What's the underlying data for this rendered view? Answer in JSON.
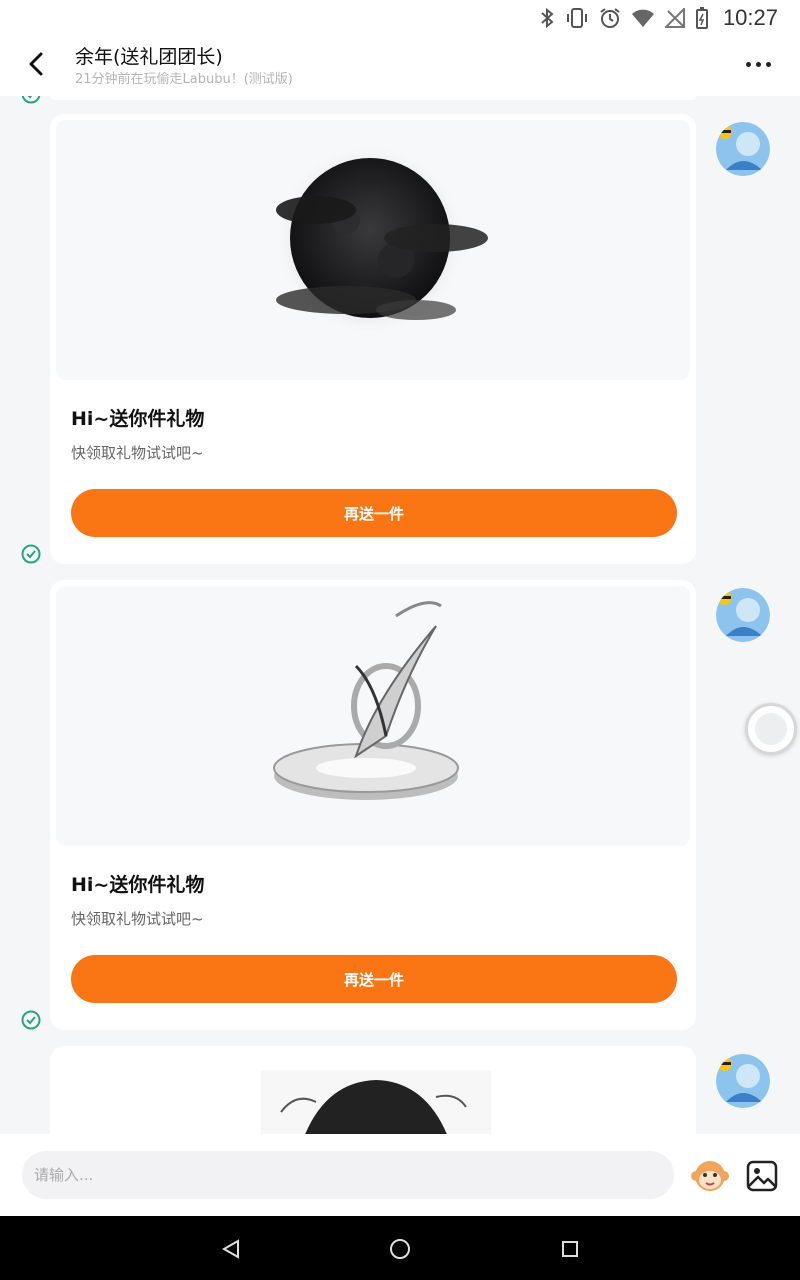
{
  "status_bar": {
    "time": "10:27"
  },
  "header": {
    "title": "余年(送礼团团长)",
    "subtitle": "21分钟前在玩偷走Labubu！(测试版)"
  },
  "messages": [
    {
      "title": "Hi~送你件礼物",
      "desc": "快领取礼物试试吧~",
      "button": "再送一件",
      "image": "dark-moon-clouds",
      "status": "sent"
    },
    {
      "title": "Hi~送你件礼物",
      "desc": "快领取礼物试试吧~",
      "button": "再送一件",
      "image": "feather-crystal-pedestal",
      "status": "sent"
    },
    {
      "image": "dark-hair-portrait"
    }
  ],
  "input": {
    "placeholder": "请输入..."
  },
  "icons": {
    "back": "back-arrow-icon",
    "more": "more-dots-icon",
    "check": "check-circle-icon",
    "emoji": "monkey-emoji-icon",
    "image": "image-picker-icon"
  },
  "colors": {
    "accent": "#fa7514",
    "check": "#2aa57a",
    "background": "#f4f6f8"
  }
}
